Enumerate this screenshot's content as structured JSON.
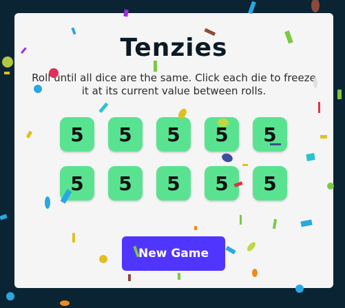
{
  "game": {
    "title": "Tenzies",
    "instructions": "Roll until all dice are the same. Click each die to freeze it at its current value between rolls.",
    "dice": [
      5,
      5,
      5,
      5,
      5,
      5,
      5,
      5,
      5,
      5
    ],
    "button_label": "New Game",
    "colors": {
      "background": "#0b2434",
      "card": "#f5f5f5",
      "die": "#59e391",
      "button": "#5035ff"
    }
  }
}
